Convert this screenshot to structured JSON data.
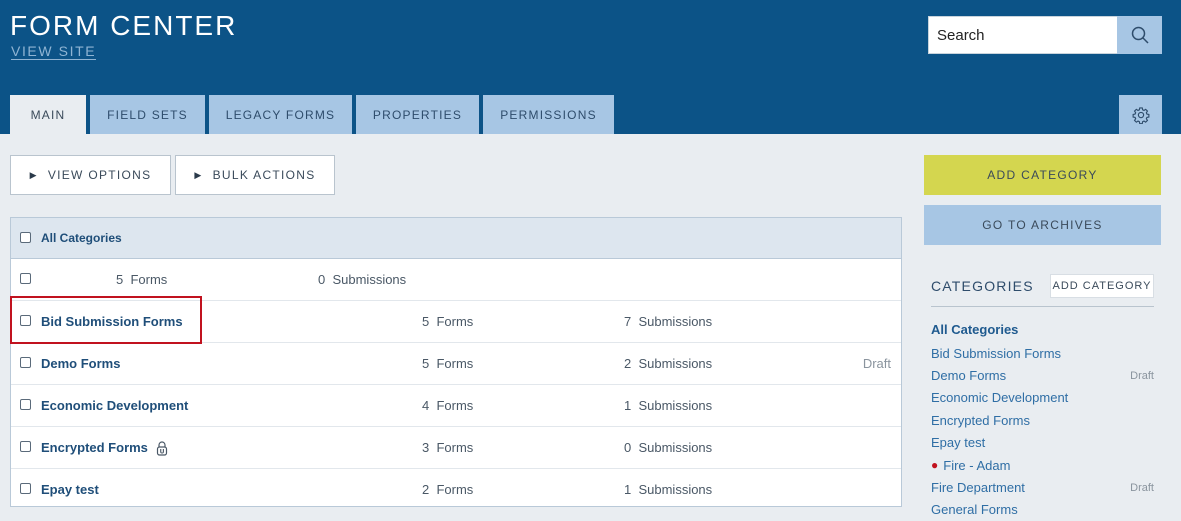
{
  "header": {
    "title": "FORM CENTER",
    "view_site": "VIEW SITE",
    "search": {
      "placeholder": "Search",
      "value": ""
    },
    "colors": {
      "bg": "#0c5387",
      "tab": "#a7c6e4"
    }
  },
  "tabs": [
    {
      "label": "MAIN",
      "active": true
    },
    {
      "label": "FIELD SETS"
    },
    {
      "label": "LEGACY FORMS"
    },
    {
      "label": "PROPERTIES"
    },
    {
      "label": "PERMISSIONS"
    }
  ],
  "toolbar": {
    "view_options": "VIEW OPTIONS",
    "bulk_actions": "BULK ACTIONS"
  },
  "table": {
    "header_label": "All Categories",
    "rows": [
      {
        "name": "",
        "forms": "5",
        "forms_label": "Forms",
        "submissions": "0",
        "submissions_label": "Submissions",
        "status": ""
      },
      {
        "name": "Bid Submission Forms",
        "forms": "5",
        "forms_label": "Forms",
        "submissions": "7",
        "submissions_label": "Submissions",
        "status": ""
      },
      {
        "name": "Demo Forms",
        "forms": "5",
        "forms_label": "Forms",
        "submissions": "2",
        "submissions_label": "Submissions",
        "status": "Draft"
      },
      {
        "name": "Economic Development",
        "forms": "4",
        "forms_label": "Forms",
        "submissions": "1",
        "submissions_label": "Submissions",
        "status": ""
      },
      {
        "name": "Encrypted Forms",
        "forms": "3",
        "forms_label": "Forms",
        "submissions": "0",
        "submissions_label": "Submissions",
        "status": "",
        "icon": "lock-icon"
      },
      {
        "name": "Epay test",
        "forms": "2",
        "forms_label": "Forms",
        "submissions": "1",
        "submissions_label": "Submissions",
        "status": ""
      }
    ]
  },
  "sidebar": {
    "add_category": "ADD CATEGORY",
    "go_to_archives": "GO TO ARCHIVES",
    "categories_heading": "CATEGORIES",
    "add_category_small": "ADD CATEGORY",
    "categories": [
      {
        "label": "All Categories",
        "draft": ""
      },
      {
        "label": "Bid Submission Forms",
        "draft": ""
      },
      {
        "label": "Demo Forms",
        "draft": "Draft"
      },
      {
        "label": "Economic Development",
        "draft": ""
      },
      {
        "label": "Encrypted Forms",
        "draft": ""
      },
      {
        "label": "Epay test",
        "draft": ""
      },
      {
        "label": "Fire - Adam",
        "draft": ""
      },
      {
        "label": "Fire Department",
        "draft": "Draft"
      },
      {
        "label": "General Forms",
        "draft": ""
      }
    ]
  }
}
